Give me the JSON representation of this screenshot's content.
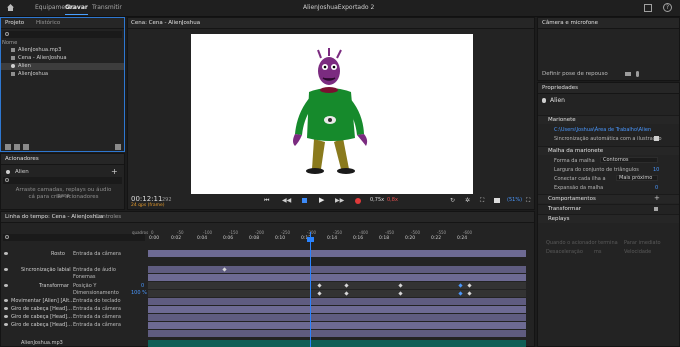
{
  "top": {
    "nav": [
      "Equipamento",
      "Gravar",
      "Transmitir"
    ],
    "active_nav": "Gravar",
    "title": "AlienJoshuaExportado 2"
  },
  "project": {
    "tabs": [
      "Projeto",
      "Histórico"
    ],
    "column": "Nome",
    "items": [
      "AlienJoshua.mp3",
      "Cena - AlienJoshua",
      "Alien",
      "AlienJoshua"
    ],
    "selected_index": 2
  },
  "triggers": {
    "title": "Acionadores",
    "item": "Alien",
    "empty_text": [
      "Arraste camadas, replays ou áudio para",
      "cá para criar acionadores"
    ]
  },
  "scene": {
    "title": "Cena: Cena - AlienJoshua",
    "timecode": "00:12:11",
    "fps": "24 qps (frame)",
    "framecount": "292",
    "zoom_a": "0,75x",
    "zoom_b": "0,8x",
    "zoom_pct": "(51%)"
  },
  "timeline": {
    "tabs": [
      "Linha do tempo: Cena - AlienJoshua",
      "Controles"
    ],
    "ruler_start": "quadros",
    "ruler_labels": [
      "0:00",
      "0:02",
      "0:04",
      "0:06",
      "0:08",
      "0:10",
      "0:12",
      "0:14",
      "0:16",
      "0:18",
      "0:20",
      "0:22",
      "0:24"
    ],
    "ruler_offsets": [
      "0",
      "-50",
      "-100",
      "-150",
      "-200",
      "-250",
      "-300",
      "-350",
      "-400",
      "-450",
      "-500",
      "-550",
      "-600"
    ],
    "rows": [
      {
        "label": "Rosto",
        "value": "Entrada da câmera"
      },
      {
        "label": "Sincronização labial",
        "value": "Entrada de áudio"
      },
      {
        "label": "",
        "value": "Fonemas"
      },
      {
        "label": "Transformar",
        "value": "Posição Y"
      },
      {
        "label": "",
        "value": "Dimensionamento"
      },
      {
        "label": "Movimentar [Alien] [Alt...",
        "value": "Entrada do teclado"
      },
      {
        "label": "Giro de cabeça [Head]...",
        "value": "Entrada da câmera"
      },
      {
        "label": "Giro de cabeça [Head]...",
        "value": "Entrada da câmera"
      },
      {
        "label": "Giro de cabeça [Head]...",
        "value": "Entrada da câmera"
      },
      {
        "label": "AlienJoshua.mp3",
        "value": ""
      }
    ],
    "percent": "100 %",
    "position_y": "0"
  },
  "camera": {
    "title": "Câmera e microfone",
    "rest_pose": "Definir pose de repouso"
  },
  "properties": {
    "title": "Propriedades",
    "puppet": "Alien",
    "sections": {
      "marionete": "Marionete",
      "malha": "Malha da marionete",
      "comportamentos": "Comportamentos",
      "transformar": "Transformar",
      "replays": "Replays"
    },
    "puppet_path": "C:\\Users\\Joshua\\Área de Trabalho\\Alien",
    "auto_sync": "Sincronização automática com a ilustração",
    "mesh": {
      "shape_label": "Forma da malha",
      "shape_value": "Contornos",
      "width_label": "Largura do conjunto de triângulos",
      "width_value": "10",
      "connect_label": "Conectar cada ilha a",
      "connect_value": "Mais próximo",
      "expansion_label": "Expansão da malha",
      "expansion_value": "0"
    },
    "replays_faded": [
      {
        "label": "Quando o acionador termina",
        "value": "Parar imediato"
      },
      {
        "label": "Desaceleração",
        "value": "ms",
        "extra": "Velocidade"
      }
    ]
  },
  "colors": {
    "accent": "#4a98ff",
    "playhead": "#2a83ff",
    "record": "#e03a3a",
    "track": "#5f5c80",
    "audio": "#0f5f56"
  }
}
